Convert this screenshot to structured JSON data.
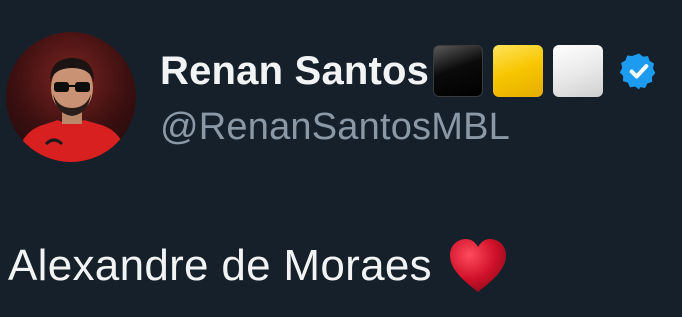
{
  "user": {
    "display_name": "Renan Santos",
    "handle": "@RenanSantosMBL",
    "verified": true,
    "name_emojis": [
      "black-square",
      "yellow-square",
      "white-square"
    ]
  },
  "tweet": {
    "text": "Alexandre de Moraes",
    "trailing_emoji": "red-heart"
  },
  "colors": {
    "background": "#15202b",
    "name": "#f2f3f4",
    "handle": "#8b98a5",
    "verified_badge": "#1d9bf0",
    "heart": "#d0122a"
  }
}
